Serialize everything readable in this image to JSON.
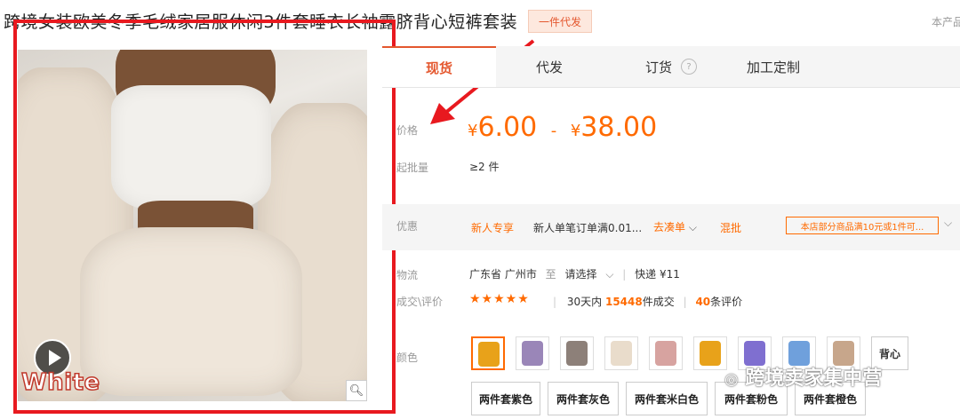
{
  "product": {
    "title": "跨境女装欧美冬季毛绒家居服休闲3件套睡衣长袖露脐背心短裤套装",
    "badge": "一件代发",
    "top_right_text": "本产品"
  },
  "image": {
    "watermark_text": "White",
    "play_icon": "play-icon",
    "zoom_icon": "magnifier-icon"
  },
  "tabs": [
    {
      "label": "现货",
      "active": true
    },
    {
      "label": "代发",
      "active": false
    },
    {
      "label": "订货",
      "active": false
    },
    {
      "label": "加工定制",
      "active": false
    }
  ],
  "help_mark": "?",
  "price": {
    "label": "价格",
    "currency": "¥",
    "low": "6.00",
    "separator": "-",
    "high": "38.00"
  },
  "moq": {
    "label": "起批量",
    "value": "≥2 件"
  },
  "promo": {
    "label": "优惠",
    "new_user": "新人专享",
    "desc": "新人单笔订单满0.01...",
    "link": "去凑单",
    "mix": "混批",
    "store_rule": "本店部分商品满10元或1件可..."
  },
  "logistics": {
    "label": "物流",
    "origin": "广东省 广州市",
    "to": "至",
    "select": "请选择",
    "express": "快递 ¥11"
  },
  "deals": {
    "label": "成交\\评价",
    "stars": "★★★★★",
    "prefix": "30天内",
    "count": "15448",
    "suffix": "件成交",
    "reviews": "40",
    "reviews_suffix": "条评价"
  },
  "colors": {
    "label": "颜色",
    "swatch_colors": [
      "#e8a21a",
      "#9a86b8",
      "#8d8079",
      "#e9dccb",
      "#d7a3a0",
      "#e8a21a",
      "#7f6fd0",
      "#6fa0dc",
      "#c7a68b"
    ],
    "text_option": "背心",
    "options": [
      "两件套紫色",
      "两件套灰色",
      "两件套米白色",
      "两件套粉色",
      "两件套橙色"
    ]
  },
  "watermark": "跨境卖家集中营"
}
